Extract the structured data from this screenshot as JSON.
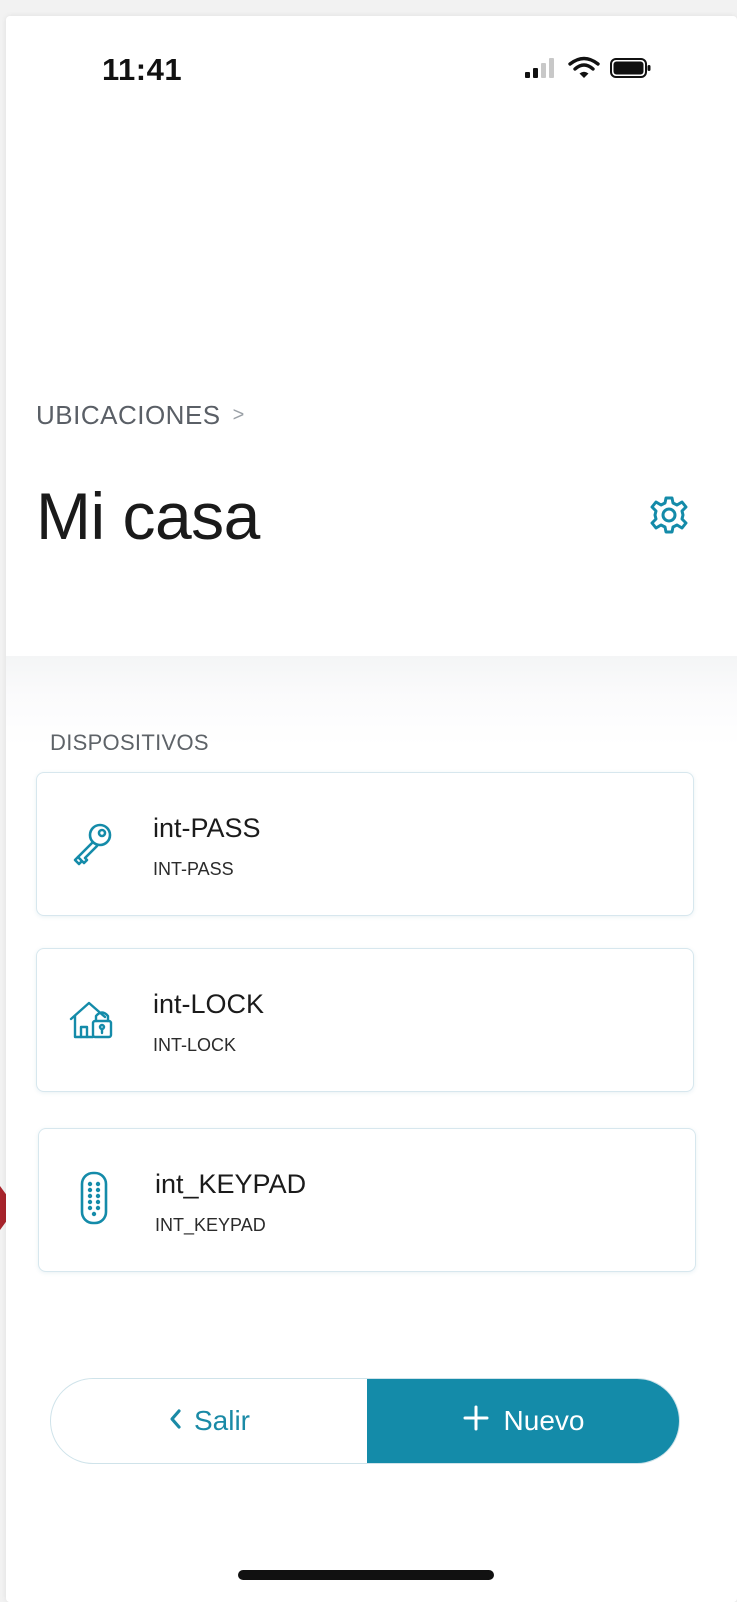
{
  "status_bar": {
    "time": "11:41"
  },
  "breadcrumb": {
    "label": "UBICACIONES",
    "arrow": ">"
  },
  "page": {
    "title": "Mi casa"
  },
  "devices_section": {
    "label": "DISPOSITIVOS",
    "items": [
      {
        "name": "int-PASS",
        "model": "INT-PASS",
        "icon": "key-icon"
      },
      {
        "name": "int-LOCK",
        "model": "INT-LOCK",
        "icon": "house-lock-icon"
      },
      {
        "name": "int_KEYPAD",
        "model": "INT_KEYPAD",
        "icon": "keypad-icon"
      }
    ]
  },
  "actions": {
    "exit_label": "Salir",
    "new_label": "Nuevo"
  },
  "colors": {
    "accent": "#148ba9",
    "text": "#1a1a1a",
    "marker": "#a8242c"
  }
}
